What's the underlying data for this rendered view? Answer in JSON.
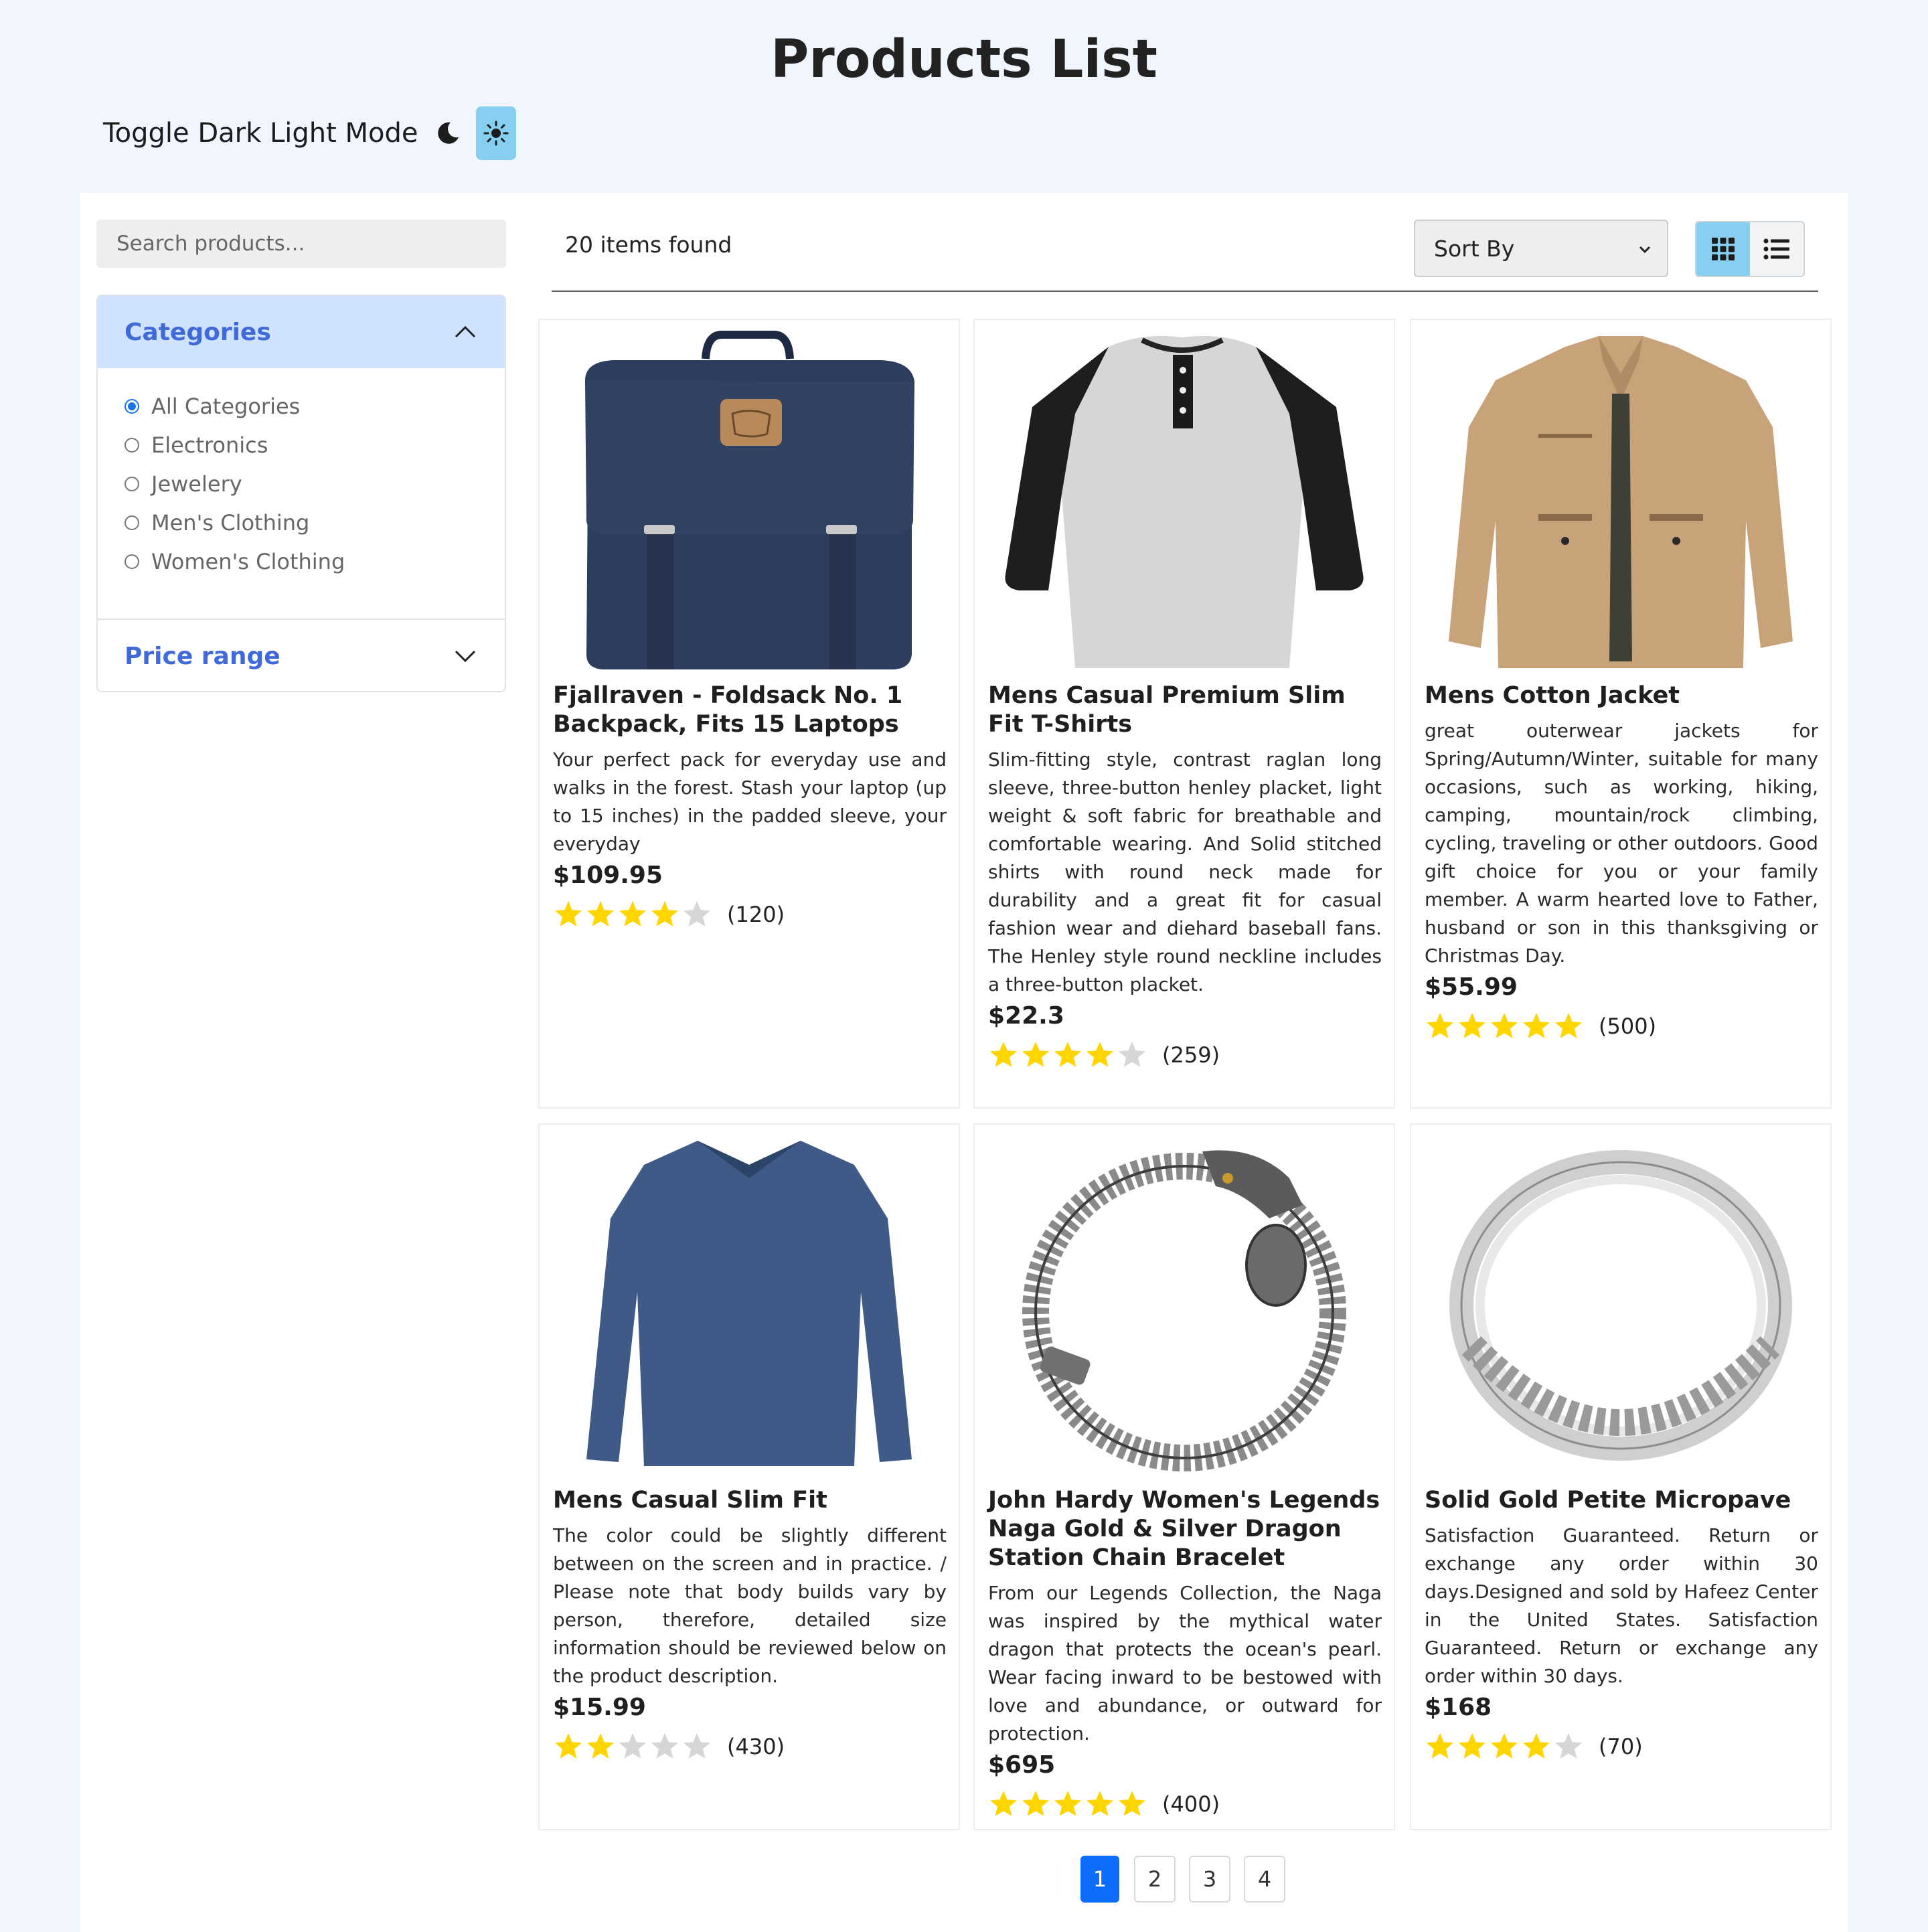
{
  "page": {
    "title": "Products List"
  },
  "mode": {
    "label": "Toggle Dark Light Mode"
  },
  "search": {
    "placeholder": "Search products..."
  },
  "filters": {
    "categories_title": "Categories",
    "categories": [
      {
        "label": "All Categories",
        "checked": true
      },
      {
        "label": "Electronics",
        "checked": false
      },
      {
        "label": "Jewelery",
        "checked": false
      },
      {
        "label": "Men's Clothing",
        "checked": false
      },
      {
        "label": "Women's Clothing",
        "checked": false
      }
    ],
    "price_range_title": "Price range"
  },
  "toolbar": {
    "items_found": "20 items found",
    "sort_label": "Sort By",
    "view_mode": "grid"
  },
  "products": [
    {
      "title": "Fjallraven - Foldsack No. 1 Backpack, Fits 15 Laptops",
      "description": "Your perfect pack for everyday use and walks in the forest. Stash your laptop (up to 15 inches) in the padded sleeve, your everyday",
      "price": "$109.95",
      "rating": 4,
      "count": "(120)",
      "image": "backpack"
    },
    {
      "title": "Mens Casual Premium Slim Fit T-Shirts",
      "description": "Slim-fitting style, contrast raglan long sleeve, three-button henley placket, light weight & soft fabric for breathable and comfortable wearing. And Solid stitched shirts with round neck made for durability and a great fit for casual fashion wear and diehard baseball fans. The Henley style round neckline includes a three-button placket.",
      "price": "$22.3",
      "rating": 4,
      "count": "(259)",
      "image": "henley-shirt"
    },
    {
      "title": "Mens Cotton Jacket",
      "description": "great outerwear jackets for Spring/Autumn/Winter, suitable for many occasions, such as working, hiking, camping, mountain/rock climbing, cycling, traveling or other outdoors. Good gift choice for you or your family member. A warm hearted love to Father, husband or son in this thanksgiving or Christmas Day.",
      "price": "$55.99",
      "rating": 5,
      "count": "(500)",
      "image": "cotton-jacket"
    },
    {
      "title": "Mens Casual Slim Fit",
      "description": "The color could be slightly different between on the screen and in practice. / Please note that body builds vary by person, therefore, detailed size information should be reviewed below on the product description.",
      "price": "$15.99",
      "rating": 2,
      "count": "(430)",
      "image": "long-sleeve-shirt"
    },
    {
      "title": "John Hardy Women's Legends Naga Gold & Silver Dragon Station Chain Bracelet",
      "description": "From our Legends Collection, the Naga was inspired by the mythical water dragon that protects the ocean's pearl. Wear facing inward to be bestowed with love and abundance, or outward for protection.",
      "price": "$695",
      "rating": 5,
      "count": "(400)",
      "image": "dragon-bracelet"
    },
    {
      "title": "Solid Gold Petite Micropave",
      "description": "Satisfaction Guaranteed. Return or exchange any order within 30 days.Designed and sold by Hafeez Center in the United States. Satisfaction Guaranteed. Return or exchange any order within 30 days.",
      "price": "$168",
      "rating": 4,
      "count": "(70)",
      "image": "micropave-ring"
    }
  ],
  "pagination": {
    "pages": [
      "1",
      "2",
      "3",
      "4"
    ],
    "active": "1"
  },
  "colors": {
    "background": "#f1f5fd",
    "accent": "#3f6ad8",
    "star": "#ffd500",
    "star_empty": "#d6d6d6",
    "active_page": "#0d6efd",
    "toggle_active": "#86cff0"
  }
}
